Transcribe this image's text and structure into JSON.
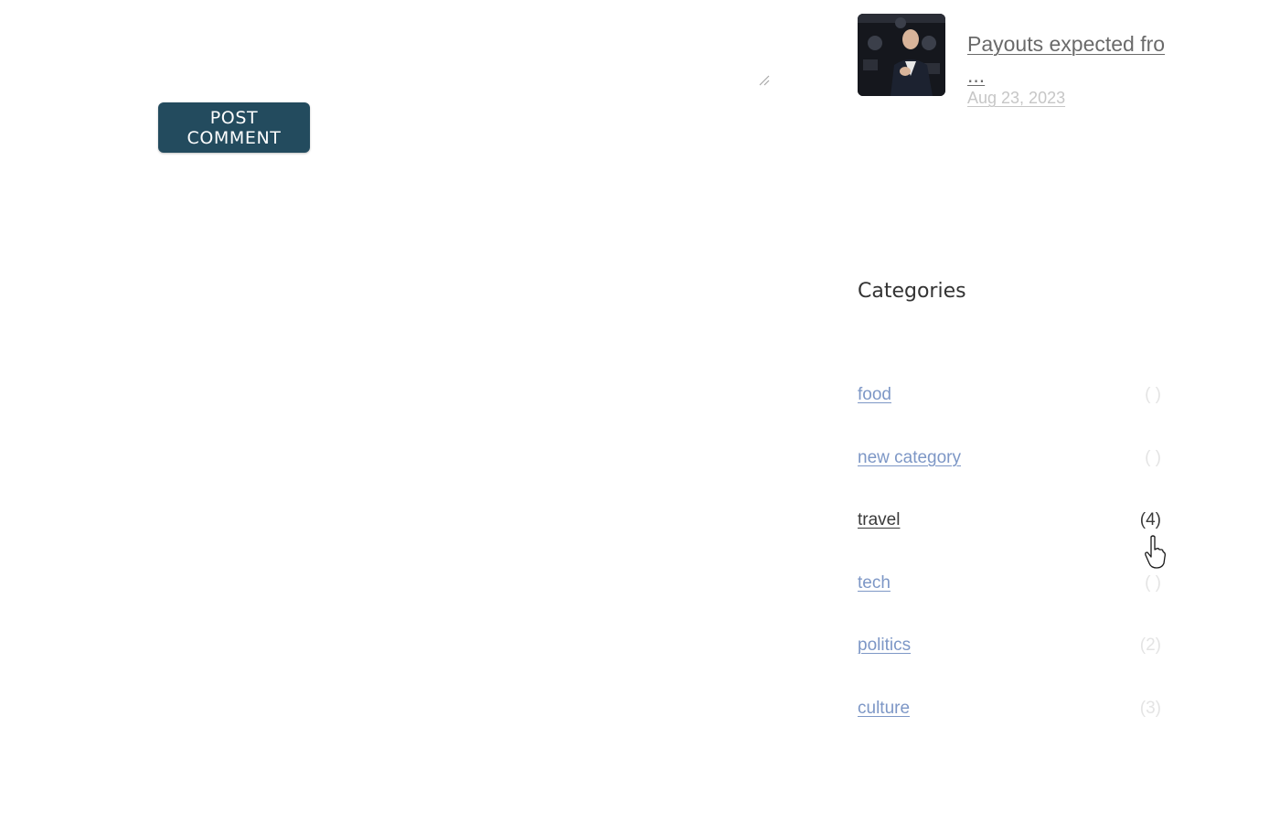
{
  "comment_form": {
    "submit_label": "POST COMMENT"
  },
  "recent_post": {
    "title": "Payouts expected fro ...",
    "date": "Aug 23, 2023"
  },
  "categories": {
    "heading": "Categories",
    "items": [
      {
        "label": "food",
        "count": "( )"
      },
      {
        "label": "new category",
        "count": "( )"
      },
      {
        "label": "travel",
        "count": "(4)"
      },
      {
        "label": "tech",
        "count": "( )"
      },
      {
        "label": "politics",
        "count": "(2)"
      },
      {
        "label": "culture",
        "count": "(3)"
      }
    ]
  },
  "colors": {
    "button_bg": "#234b5e",
    "link": "#7d97c6",
    "link_active": "#3a3a3a"
  },
  "icons": {
    "resize": "textarea-resize-icon",
    "cursor": "hand-pointer-icon"
  }
}
